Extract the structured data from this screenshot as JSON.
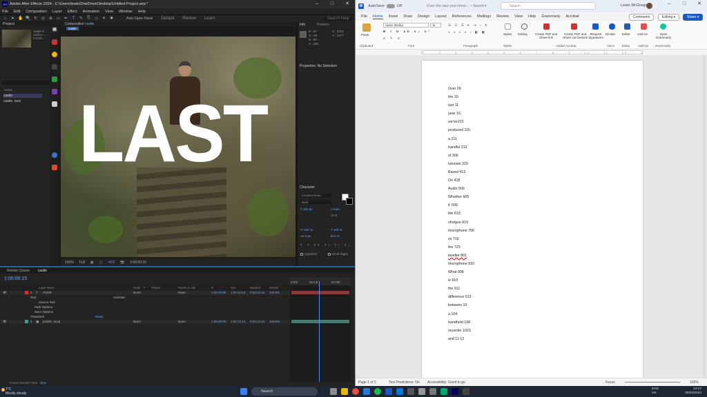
{
  "ae": {
    "title": "Adobe After Effects 2024 - C:\\Users\\lewis\\OneDrive\\Desktop\\Untitled Project.aep *",
    "logo": "Ae",
    "menu": [
      "File",
      "Edit",
      "Composition",
      "Layer",
      "Effect",
      "Animation",
      "View",
      "Window",
      "Help"
    ],
    "toolbar": {
      "auto_open": "Auto-Open Panel",
      "workspaces": [
        "Default",
        "Review",
        "Learn"
      ],
      "search": "Search Help"
    },
    "project": {
      "tab": "Project",
      "comp_name": "castle",
      "comp_meta": [
        "castle ▾",
        "1440 x ...",
        "0:0:00..."
      ],
      "col_name": "Name",
      "items": [
        "castle",
        "castle .mov"
      ]
    },
    "viewer": {
      "tab": "Composition",
      "comp_name": "castle",
      "sub_tab": "castle",
      "text_layer": "LAST",
      "zoom": "100%",
      "quality": "Full",
      "timecode": "0:00:00:15",
      "exposure": "+0.0"
    },
    "info": {
      "tab": "Info",
      "preview": "Preview",
      "rows": [
        "R : 97",
        "G : 96",
        "B : 89",
        "A : 255"
      ],
      "coords": [
        "X : 2312",
        "Y : 1477"
      ]
    },
    "properties": {
      "tab": "Properties: No Selection"
    },
    "character": {
      "tab": "Character",
      "font": "Linotext Neue",
      "style": "Bold",
      "size": "182 px",
      "leading": "Auto",
      "tracking": "0",
      "vscale": "100 %",
      "hscale": "100 %",
      "baseline": "0 px",
      "tsume": "0 %",
      "ligatures": "Ligatures",
      "hindi": "Hindi Digits",
      "colors": {
        "fill": "#ffffff",
        "stroke": "#000000"
      }
    },
    "timeline": {
      "tabs": [
        "Render Queue",
        "castle"
      ],
      "timecode": "1:00:00:15",
      "headers": [
        "Layer Name",
        "Mode",
        "T",
        "TrkMat",
        "Parent & Link",
        "In",
        "Out",
        "Duration",
        "Stretch"
      ],
      "ruler": [
        "0:00f",
        "00:12f",
        "01:00f"
      ],
      "layers": [
        {
          "num": "1",
          "name": "OVER",
          "mode": "Norm",
          "parent": "None",
          "in": "1:00:00:00",
          "out": "1:00:12:15",
          "dur": "0:00:12:16",
          "stretch": "100.0%"
        },
        {
          "num": "2",
          "name": "[castle .mov]",
          "mode": "Norm",
          "parent": "None",
          "in": "1:00:00:00",
          "out": "1:00:12:15",
          "dur": "0:00:12:16",
          "stretch": "100.0%"
        }
      ],
      "sub": [
        "Text",
        "Source Text",
        "Path Options",
        "More Options",
        "Transform"
      ],
      "animate": "Animate:",
      "reset": "Reset",
      "frame_render": "Frame Render Time",
      "frame_render_val": "5ms"
    }
  },
  "word": {
    "logo": "W",
    "autosave": "AutoSave",
    "autosave_state": "Off",
    "doc_title": "Over the last year done... • Saved ▾",
    "search": "Search",
    "user": "Lewis McGregor",
    "menu": [
      "File",
      "Home",
      "Insert",
      "Draw",
      "Design",
      "Layout",
      "References",
      "Mailings",
      "Review",
      "View",
      "Help",
      "Grammarly",
      "Acrobat"
    ],
    "active_menu": "Home",
    "buttons": {
      "comments": "Comments",
      "editing": "Editing ▾",
      "share": "Share ▾"
    },
    "ribbon": {
      "paste": "Paste",
      "font": "Aptos (Body)",
      "size": "11",
      "styles": "Styles",
      "editing": "Editing",
      "create_pdf": "Create PDF and Share link",
      "create_pdf_outlook": "Create PDF and Share via Outlook",
      "request_sig": "Request Signatures",
      "dictate": "Dictate",
      "editor": "Editor",
      "addins": "Add-ins",
      "grammarly": "Open Grammarly",
      "groups": [
        "Clipboard",
        "Font",
        "Paragraph",
        "Styles",
        "Adobe Acrobat",
        "Voice",
        "Editor",
        "Add-ins",
        "Grammarly"
      ]
    },
    "ruler": "1 · · · 1 · · · 2 · · · 3 · · · 4 · · · 5 · · · 6 · · · 7 · · · 8 · · · 9 · · · 10 · · · 11 · · · 12 · · · 13 · · · 14 · · · 15 · · · 16 · · · 17 · · · 18",
    "lines": [
      "Over 09",
      "the 10",
      "last 11",
      "year 10,",
      "we've103",
      "produced 116",
      "a 211",
      "handful 212",
      "of 306",
      "tutorials 315",
      "Based 413",
      "On 418",
      "Audio 509",
      "Whether 605",
      "it' 609",
      "the 610",
      "shotgun 615",
      "microphone 700",
      "vs 719",
      "the 723",
      "lavelier 801",
      "microphone 810",
      "What 908",
      "is 910",
      "the 911",
      " difference 913",
      "between 10",
      "a 104",
      "handheld 108",
      "recorder 1021",
      "and 11:12"
    ],
    "status": {
      "page": "Page 1 of 2",
      "text_pred": "Text Predictions: On",
      "accessibility": "Accessibility: Good to go",
      "focus": "Focus",
      "zoom": "100%"
    }
  },
  "taskbar": {
    "temp": "7°C",
    "weather": "Mostly cloudy",
    "search": "Search",
    "lang": "ENG",
    "region": "UK",
    "time": "13:17",
    "date": "28/03/2024"
  }
}
